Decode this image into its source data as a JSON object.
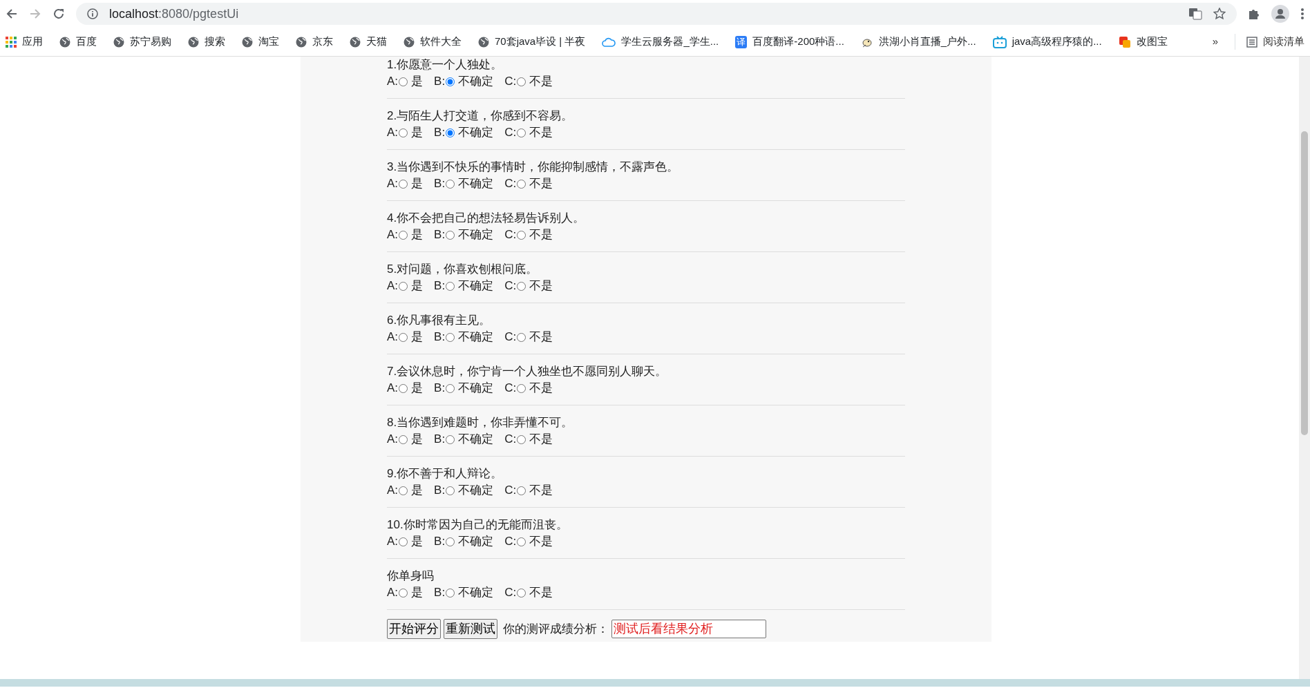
{
  "browser": {
    "url_host": "localhost",
    "url_rest": ":8080/pgtestUi",
    "bookmarks": [
      {
        "label": "应用",
        "kind": "apps"
      },
      {
        "label": "百度",
        "kind": "globe"
      },
      {
        "label": "苏宁易购",
        "kind": "globe"
      },
      {
        "label": "搜索",
        "kind": "globe"
      },
      {
        "label": "淘宝",
        "kind": "globe"
      },
      {
        "label": "京东",
        "kind": "globe"
      },
      {
        "label": "天猫",
        "kind": "globe"
      },
      {
        "label": "软件大全",
        "kind": "globe"
      },
      {
        "label": "70套java毕设 | 半夜",
        "kind": "globe"
      },
      {
        "label": "学生云服务器_学生...",
        "kind": "cloud"
      },
      {
        "label": "百度翻译-200种语...",
        "kind": "translate",
        "icon_text": "译"
      },
      {
        "label": "洪湖小肖直播_户外...",
        "kind": "bird"
      },
      {
        "label": "java高级程序猿的...",
        "kind": "tv"
      },
      {
        "label": "改图宝",
        "kind": "squares"
      }
    ],
    "more": "»",
    "reading_list": "阅读清单"
  },
  "questions": [
    {
      "text": "1.你愿意一个人独处。",
      "options": [
        {
          "letter": "A:",
          "label": "是",
          "selected": false
        },
        {
          "letter": "B:",
          "label": "不确定",
          "selected": true
        },
        {
          "letter": "C:",
          "label": "不是",
          "selected": false
        }
      ]
    },
    {
      "text": "2.与陌生人打交道，你感到不容易。",
      "options": [
        {
          "letter": "A:",
          "label": "是",
          "selected": false
        },
        {
          "letter": "B:",
          "label": "不确定",
          "selected": true
        },
        {
          "letter": "C:",
          "label": "不是",
          "selected": false
        }
      ]
    },
    {
      "text": "3.当你遇到不快乐的事情时，你能抑制感情，不露声色。",
      "options": [
        {
          "letter": "A:",
          "label": "是",
          "selected": false
        },
        {
          "letter": "B:",
          "label": "不确定",
          "selected": false
        },
        {
          "letter": "C:",
          "label": "不是",
          "selected": false
        }
      ]
    },
    {
      "text": "4.你不会把自己的想法轻易告诉别人。",
      "options": [
        {
          "letter": "A:",
          "label": "是",
          "selected": false
        },
        {
          "letter": "B:",
          "label": "不确定",
          "selected": false
        },
        {
          "letter": "C:",
          "label": "不是",
          "selected": false
        }
      ]
    },
    {
      "text": "5.对问题，你喜欢刨根问底。",
      "options": [
        {
          "letter": "A:",
          "label": "是",
          "selected": false
        },
        {
          "letter": "B:",
          "label": "不确定",
          "selected": false
        },
        {
          "letter": "C:",
          "label": "不是",
          "selected": false
        }
      ]
    },
    {
      "text": "6.你凡事很有主见。",
      "options": [
        {
          "letter": "A:",
          "label": "是",
          "selected": false
        },
        {
          "letter": "B:",
          "label": "不确定",
          "selected": false
        },
        {
          "letter": "C:",
          "label": "不是",
          "selected": false
        }
      ]
    },
    {
      "text": "7.会议休息时，你宁肯一个人独坐也不愿同别人聊天。",
      "options": [
        {
          "letter": "A:",
          "label": "是",
          "selected": false
        },
        {
          "letter": "B:",
          "label": "不确定",
          "selected": false
        },
        {
          "letter": "C:",
          "label": "不是",
          "selected": false
        }
      ]
    },
    {
      "text": "8.当你遇到难题时，你非弄懂不可。",
      "options": [
        {
          "letter": "A:",
          "label": "是",
          "selected": false
        },
        {
          "letter": "B:",
          "label": "不确定",
          "selected": false
        },
        {
          "letter": "C:",
          "label": "不是",
          "selected": false
        }
      ]
    },
    {
      "text": "9.你不善于和人辩论。",
      "options": [
        {
          "letter": "A:",
          "label": "是",
          "selected": false
        },
        {
          "letter": "B:",
          "label": "不确定",
          "selected": false
        },
        {
          "letter": "C:",
          "label": "不是",
          "selected": false
        }
      ]
    },
    {
      "text": "10.你时常因为自己的无能而沮丧。",
      "options": [
        {
          "letter": "A:",
          "label": "是",
          "selected": false
        },
        {
          "letter": "B:",
          "label": "不确定",
          "selected": false
        },
        {
          "letter": "C:",
          "label": "不是",
          "selected": false
        }
      ]
    },
    {
      "text": "你单身吗",
      "options": [
        {
          "letter": "A:",
          "label": "是",
          "selected": false
        },
        {
          "letter": "B:",
          "label": "不确定",
          "selected": false
        },
        {
          "letter": "C:",
          "label": "不是",
          "selected": false
        }
      ]
    }
  ],
  "actions": {
    "buttons": [
      "开始评分",
      "重新测试"
    ],
    "result_label": "你的测评成绩分析：",
    "result_value": "测试后看结果分析"
  }
}
